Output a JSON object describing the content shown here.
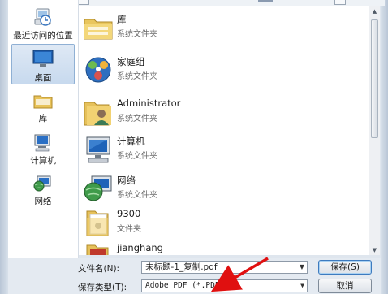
{
  "nav": {
    "items": [
      {
        "label": "最近访问的位置"
      },
      {
        "label": "桌面"
      },
      {
        "label": "库"
      },
      {
        "label": "计算机"
      },
      {
        "label": "网络"
      }
    ]
  },
  "files": [
    {
      "name": "库",
      "type": "系统文件夹"
    },
    {
      "name": "家庭组",
      "type": "系统文件夹"
    },
    {
      "name": "Administrator",
      "type": "系统文件夹"
    },
    {
      "name": "计算机",
      "type": "系统文件夹"
    },
    {
      "name": "网络",
      "type": "系统文件夹"
    },
    {
      "name": "9300",
      "type": "文件夹"
    },
    {
      "name": "jianghang",
      "type": ""
    }
  ],
  "form": {
    "filename_label": "文件名(N):",
    "filename_value": "未标题-1_复制.pdf",
    "filetype_label": "保存类型(T):",
    "filetype_value": "Adobe PDF (*.PDF)",
    "save_button": "保存(S)",
    "cancel_button": "取消"
  },
  "colors": {
    "annotation_arrow": "#e01010",
    "selection": "#c7d9ee"
  }
}
